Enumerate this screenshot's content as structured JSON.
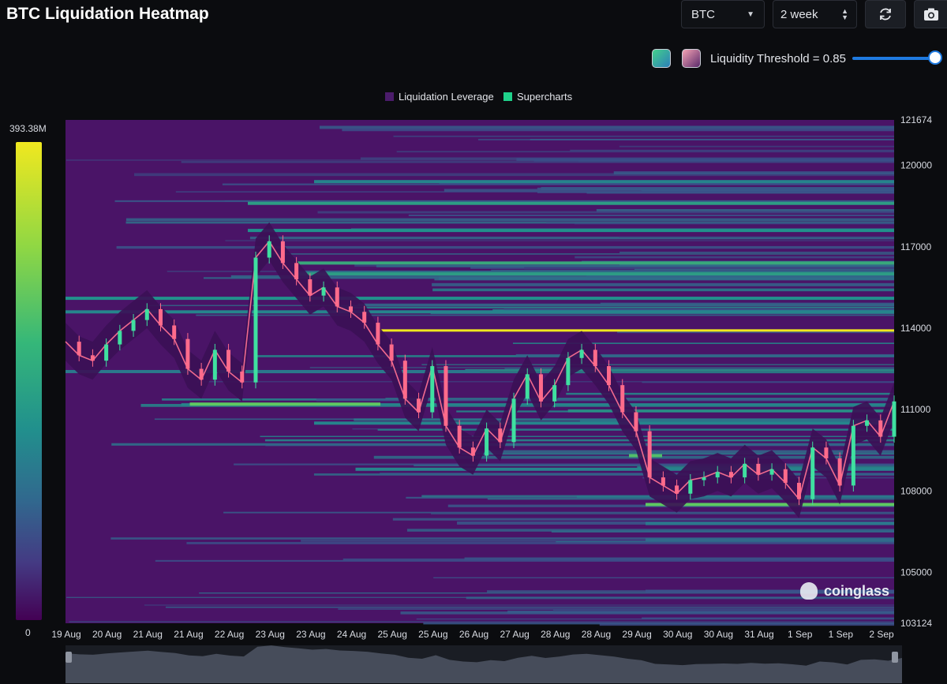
{
  "title": "BTC Liquidation Heatmap",
  "controls": {
    "symbol_value": "BTC",
    "range_value": "2 week",
    "refresh_icon": "refresh-icon",
    "camera_icon": "camera-icon"
  },
  "threshold": {
    "label": "Liquidity Threshold = 0.85",
    "value": 0.85,
    "scheme_a_colors": [
      "#44d08b",
      "#2c7fb8"
    ],
    "scheme_b_colors": [
      "#f5a3b4",
      "#5a2a6b"
    ]
  },
  "colorbar": {
    "max_label": "393.38M",
    "min_label": "0"
  },
  "watermark": "coinglass",
  "chart_data": {
    "type": "heatmap",
    "title": "BTC Liquidation Heatmap",
    "legend": [
      {
        "name": "Liquidation Leverage",
        "color": "#4b1c6b"
      },
      {
        "name": "Supercharts",
        "color": "#1fd18a"
      }
    ],
    "legend_position": "top-center",
    "y_axis": {
      "side": "right",
      "min": 103124,
      "max": 121674,
      "tick_labels": [
        "121674",
        "120000",
        "117000",
        "114000",
        "111000",
        "108000",
        "105000",
        "103124"
      ],
      "tick_values": [
        121674,
        120000,
        117000,
        114000,
        111000,
        108000,
        105000,
        103124
      ]
    },
    "x_axis": {
      "tick_labels": [
        "19 Aug",
        "20 Aug",
        "21 Aug",
        "21 Aug",
        "22 Aug",
        "23 Aug",
        "23 Aug",
        "24 Aug",
        "25 Aug",
        "25 Aug",
        "26 Aug",
        "27 Aug",
        "28 Aug",
        "28 Aug",
        "29 Aug",
        "30 Aug",
        "30 Aug",
        "31 Aug",
        "1 Sep",
        "1 Sep",
        "2 Sep"
      ]
    },
    "price_series": {
      "name": "BTC price",
      "values": [
        113500,
        113000,
        112800,
        113400,
        113900,
        114300,
        114700,
        114100,
        113600,
        112500,
        112100,
        113200,
        112400,
        112000,
        116600,
        117200,
        116400,
        115800,
        115200,
        115500,
        114800,
        114600,
        114200,
        113400,
        112800,
        111400,
        110900,
        112600,
        110400,
        109600,
        109300,
        110300,
        109800,
        111400,
        112300,
        111300,
        111900,
        112900,
        113200,
        112600,
        111900,
        110900,
        110200,
        108500,
        108200,
        107900,
        108400,
        108500,
        108700,
        108500,
        109000,
        108600,
        108800,
        108300,
        107700,
        109600,
        109200,
        108200,
        110400,
        110600,
        110000,
        111300
      ]
    },
    "heat_bands": [
      {
        "price": 113900,
        "intensity": 1.0,
        "from": 0.38,
        "to": 1.0
      },
      {
        "price": 111200,
        "intensity": 0.75,
        "from": 0.15,
        "to": 0.38
      },
      {
        "price": 109300,
        "intensity": 0.7,
        "from": 0.68,
        "to": 0.72
      },
      {
        "price": 107500,
        "intensity": 0.75,
        "from": 0.7,
        "to": 1.0
      },
      {
        "price": 116400,
        "intensity": 0.6,
        "from": 0.28,
        "to": 1.0
      },
      {
        "price": 116000,
        "intensity": 0.55,
        "from": 0.28,
        "to": 1.0
      },
      {
        "price": 117600,
        "intensity": 0.5,
        "from": 0.22,
        "to": 1.0
      },
      {
        "price": 118600,
        "intensity": 0.55,
        "from": 0.22,
        "to": 1.0
      },
      {
        "price": 119400,
        "intensity": 0.45,
        "from": 0.3,
        "to": 1.0
      },
      {
        "price": 115100,
        "intensity": 0.5,
        "from": 0.0,
        "to": 1.0
      },
      {
        "price": 114600,
        "intensity": 0.45,
        "from": 0.0,
        "to": 1.0
      },
      {
        "price": 112400,
        "intensity": 0.4,
        "from": 0.0,
        "to": 0.5
      },
      {
        "price": 110500,
        "intensity": 0.45,
        "from": 0.3,
        "to": 1.0
      },
      {
        "price": 108800,
        "intensity": 0.45,
        "from": 0.35,
        "to": 1.0
      },
      {
        "price": 106800,
        "intensity": 0.4,
        "from": 0.7,
        "to": 1.0
      },
      {
        "price": 106200,
        "intensity": 0.35,
        "from": 0.7,
        "to": 1.0
      },
      {
        "price": 104300,
        "intensity": 0.25,
        "from": 0.7,
        "to": 1.0
      }
    ]
  }
}
